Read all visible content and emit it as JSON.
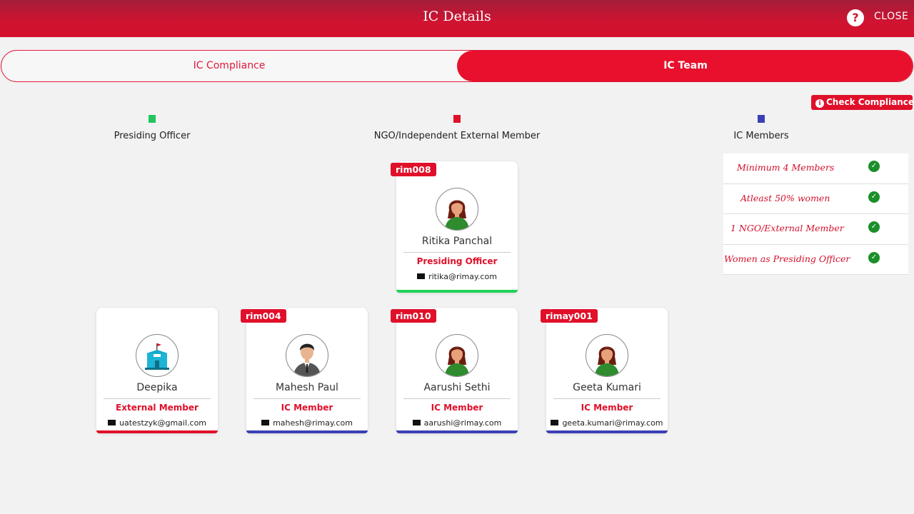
{
  "header": {
    "title": "IC Details",
    "help_icon": "question-circle-icon",
    "close_label": "CLOSE"
  },
  "tabs": [
    {
      "label": "IC Compliance",
      "active": false
    },
    {
      "label": "IC Team",
      "active": true
    }
  ],
  "check_compliance": {
    "label": "Check Compliance",
    "icon": "info-circle-icon"
  },
  "legend": [
    {
      "label": "Presiding Officer",
      "color": "#22c55e"
    },
    {
      "label": "NGO/Independent External Member",
      "color": "#e0102a"
    },
    {
      "label": "IC Members",
      "color": "#3b3fb5"
    }
  ],
  "rules": [
    {
      "label": "Minimum 4 Members",
      "status": "check-circle-icon"
    },
    {
      "label": "Atleast 50% women",
      "status": "check-circle-icon"
    },
    {
      "label": "1 NGO/External Member",
      "status": "check-circle-icon"
    },
    {
      "label": "Women as Presiding Officer",
      "status": "check-circle-icon"
    }
  ],
  "members": [
    {
      "id": "rim008",
      "name": "Ritika Panchal",
      "role": "Presiding Officer",
      "email": "ritika@rimay.com",
      "avatar": "female-avatar-icon",
      "bar_color": "#22d15a"
    },
    {
      "id": "",
      "name": "Deepika",
      "role": "External Member",
      "email": "uatestzyk@gmail.com",
      "avatar": "ngo-building-icon",
      "bar_color": "#e0102a"
    },
    {
      "id": "rim004",
      "name": "Mahesh Paul",
      "role": "IC Member",
      "email": "mahesh@rimay.com",
      "avatar": "male-avatar-icon",
      "bar_color": "#3b3fb5"
    },
    {
      "id": "rim010",
      "name": "Aarushi Sethi",
      "role": "IC Member",
      "email": "aarushi@rimay.com",
      "avatar": "female-avatar-icon",
      "bar_color": "#3b3fb5"
    },
    {
      "id": "rimay001",
      "name": "Geeta Kumari",
      "role": "IC Member",
      "email": "geeta.kumari@rimay.com",
      "avatar": "female-avatar-icon",
      "bar_color": "#3b3fb5"
    }
  ]
}
